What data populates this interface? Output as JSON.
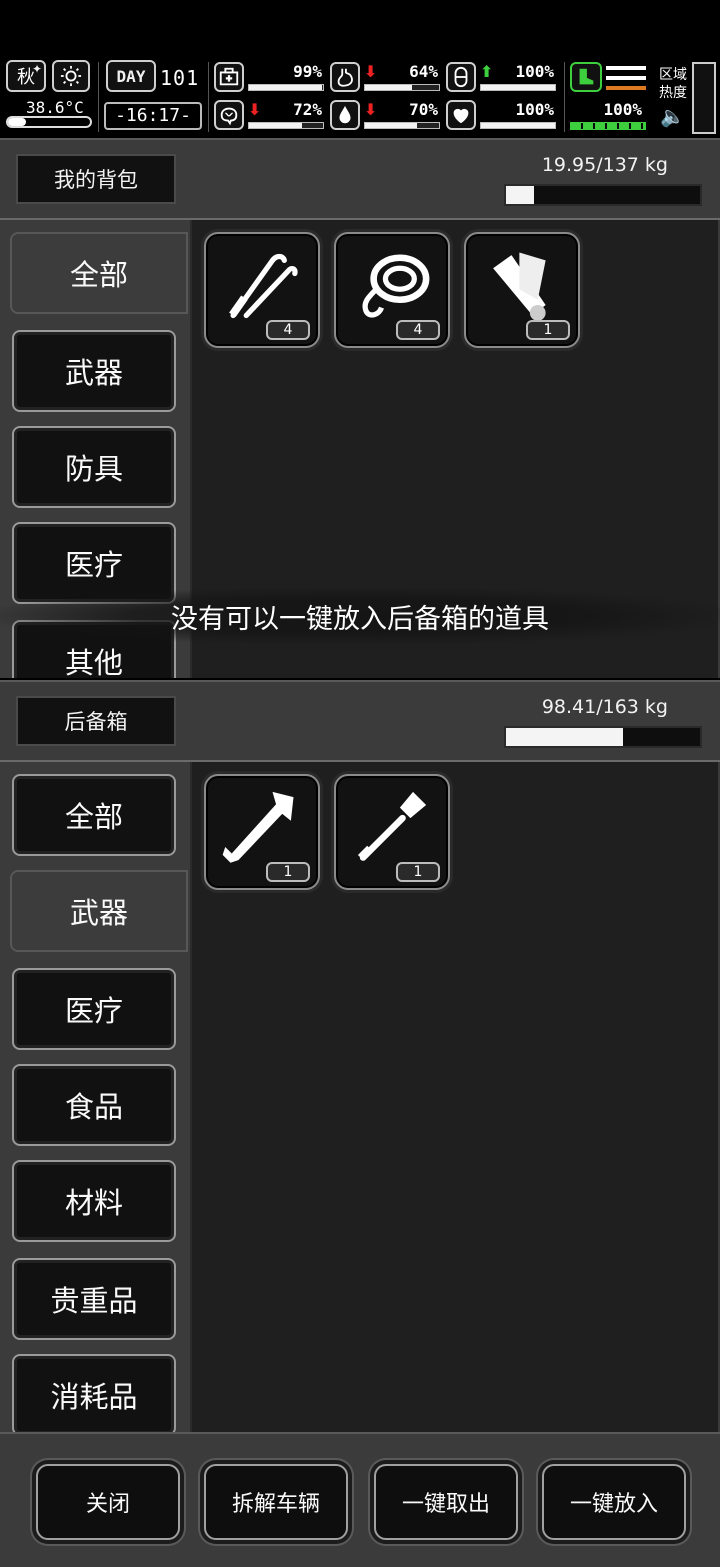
{
  "status": {
    "season": "秋",
    "temperature": "38.6°C",
    "day_label": "DAY",
    "day_number": "101",
    "clock": "-16:17-",
    "stats": [
      {
        "name": "health",
        "value": "99%",
        "level": 0.99,
        "trend": ""
      },
      {
        "name": "hunger",
        "value": "64%",
        "level": 0.64,
        "trend": "down"
      },
      {
        "name": "energy",
        "value": "100%",
        "level": 1.0,
        "trend": "up"
      },
      {
        "name": "mind",
        "value": "72%",
        "level": 0.72,
        "trend": "down"
      },
      {
        "name": "thirst",
        "value": "70%",
        "level": 0.7,
        "trend": "down"
      },
      {
        "name": "heart",
        "value": "100%",
        "level": 1.0,
        "trend": ""
      }
    ],
    "stamina_value": "100%",
    "area_heat_label": "区域热度",
    "colors": {
      "accent_green": "#3ecf3e",
      "alert_red": "#e22222"
    }
  },
  "backpack": {
    "title": "我的背包",
    "weight": "19.95/137 kg",
    "weight_fraction": 0.1456,
    "categories": [
      "全部",
      "武器",
      "防具",
      "医疗",
      "其他"
    ],
    "active_category": "全部",
    "items": [
      {
        "icon": "picks-icon",
        "count": "4"
      },
      {
        "icon": "rope-icon",
        "count": "4"
      },
      {
        "icon": "cloth-roll-icon",
        "count": "1"
      }
    ]
  },
  "trunk": {
    "title": "后备箱",
    "weight": "98.41/163 kg",
    "weight_fraction": 0.6037,
    "categories": [
      "全部",
      "武器",
      "医疗",
      "食品",
      "材料",
      "贵重品",
      "消耗品"
    ],
    "active_category": "武器",
    "items": [
      {
        "icon": "tomahawk-icon",
        "count": "1"
      },
      {
        "icon": "shovel-icon",
        "count": "1"
      }
    ]
  },
  "toast": "没有可以一键放入后备箱的道具",
  "actions": {
    "close": "关闭",
    "dismantle": "拆解车辆",
    "take_all": "一键取出",
    "put_all": "一键放入"
  }
}
